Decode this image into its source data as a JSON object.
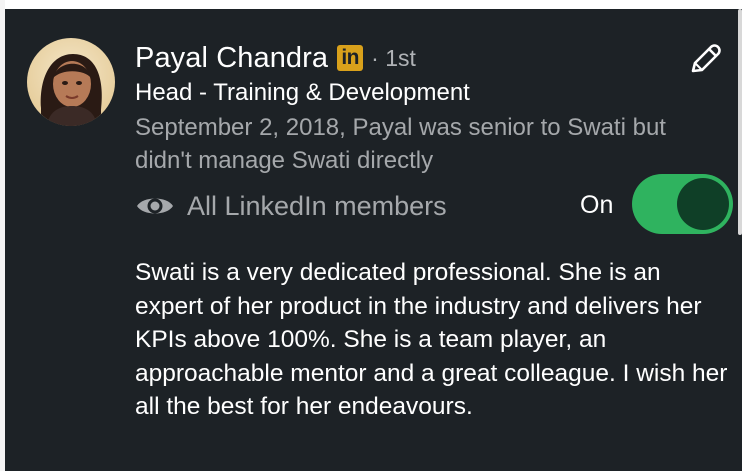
{
  "profile": {
    "name": "Payal Chandra",
    "badge_text": "in",
    "degree": "· 1st",
    "headline": "Head - Training & Development",
    "relation": "September 2, 2018, Payal was senior to Swati but didn't manage Swati directly",
    "avatar_icon": "profile-photo"
  },
  "visibility": {
    "icon": "eye-icon",
    "label": "All LinkedIn members",
    "toggle_state_label": "On",
    "toggle_on": true
  },
  "actions": {
    "edit_icon": "pencil-icon"
  },
  "recommendation": {
    "text": "Swati is a very dedicated professional. She is an expert of her product in the industry and delivers her KPIs above 100%. She is a team player, an approachable mentor and a great colleague. I wish her all the best for her endeavours."
  },
  "colors": {
    "background": "#1d2226",
    "badge": "#d9a11b",
    "toggle_track": "#2fb35f",
    "toggle_knob": "#0f3f27",
    "secondary_text": "#a5a8ab"
  }
}
